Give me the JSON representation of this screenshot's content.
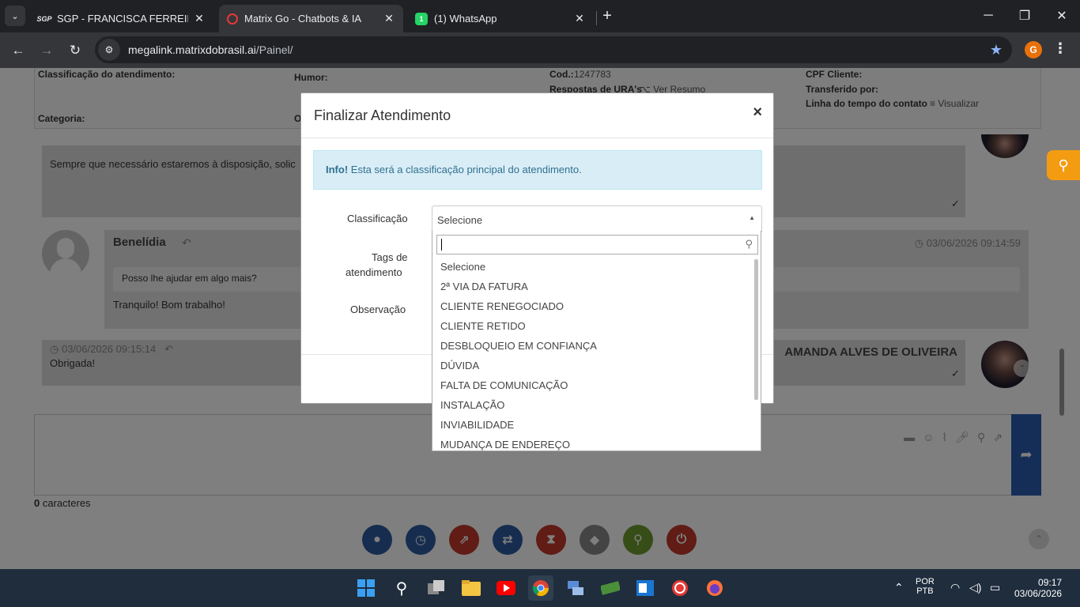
{
  "browser": {
    "tabs": [
      {
        "title": "SGP - FRANCISCA FERREIRA DA",
        "favicon": "SGP",
        "active": false
      },
      {
        "title": "Matrix Go - Chatbots & IA",
        "favicon": "Q",
        "active": true
      },
      {
        "title": "(1) WhatsApp",
        "favicon": "1",
        "active": false
      }
    ],
    "url_host": "megalink.matrixdobrasil.ai",
    "url_path": "/Painel/",
    "profile_initial": "G"
  },
  "info_panel": {
    "classificacao_label": "Classificação do atendimento:",
    "categoria_label": "Categoria:",
    "humor_label": "Humor:",
    "o_label": "O",
    "cod_label": "Cod.:",
    "cod_value": "1247783",
    "respostas_label": "Respostas de URA's",
    "ver_resumo": "Ver Resumo",
    "cpf_label": "CPF Cliente:",
    "transferido_label": "Transferido por:",
    "linha_label": "Linha do tempo do contato",
    "visualizar": "Visualizar"
  },
  "chat": {
    "msg1_text": "Sempre que necessário estaremos à disposição, solic",
    "agent_name": "Benelídia",
    "agent_timestamp": "03/06/2026 09:14:59",
    "quoted_text": "Posso lhe ajudar em algo mais?",
    "agent_reply": "Tranquilo! Bom trabalho!",
    "client_timestamp": "03/06/2026 09:15:14",
    "client_text": "Obrigada!",
    "client_name": "AMANDA ALVES DE OLIVEIRA"
  },
  "compose": {
    "char_count": "0",
    "char_label": "caracteres"
  },
  "modal": {
    "title": "Finalizar Atendimento",
    "close": "×",
    "alert_strong": "Info!",
    "alert_text": "Esta será a classificação principal do atendimento.",
    "classificacao_label": "Classificação",
    "tags_label_1": "Tags de",
    "tags_label_2": "atendimento",
    "observacao_label": "Observação",
    "select_value": "Selecione"
  },
  "dropdown": {
    "search_value": "",
    "options": [
      "Selecione",
      "2ª VIA DA FATURA",
      "CLIENTE RENEGOCIADO",
      "CLIENTE RETIDO",
      "DESBLOQUEIO EM CONFIANÇA",
      "DÚVIDA",
      "FALTA DE COMUNICAÇÃO",
      "INSTALAÇÃO",
      "INVIABILIDADE",
      "MUDANÇA DE ENDEREÇO"
    ]
  },
  "taskbar": {
    "lang_1": "POR",
    "lang_2": "PTB",
    "time": "09:17",
    "date": "03/06/2026"
  },
  "colors": {
    "accent_blue": "#2a5db0",
    "search_orange": "#f39c12",
    "action_red": "#c0392b",
    "action_blue": "#2c5aa0",
    "action_gray": "#888888",
    "action_green": "#6f9a2e"
  }
}
